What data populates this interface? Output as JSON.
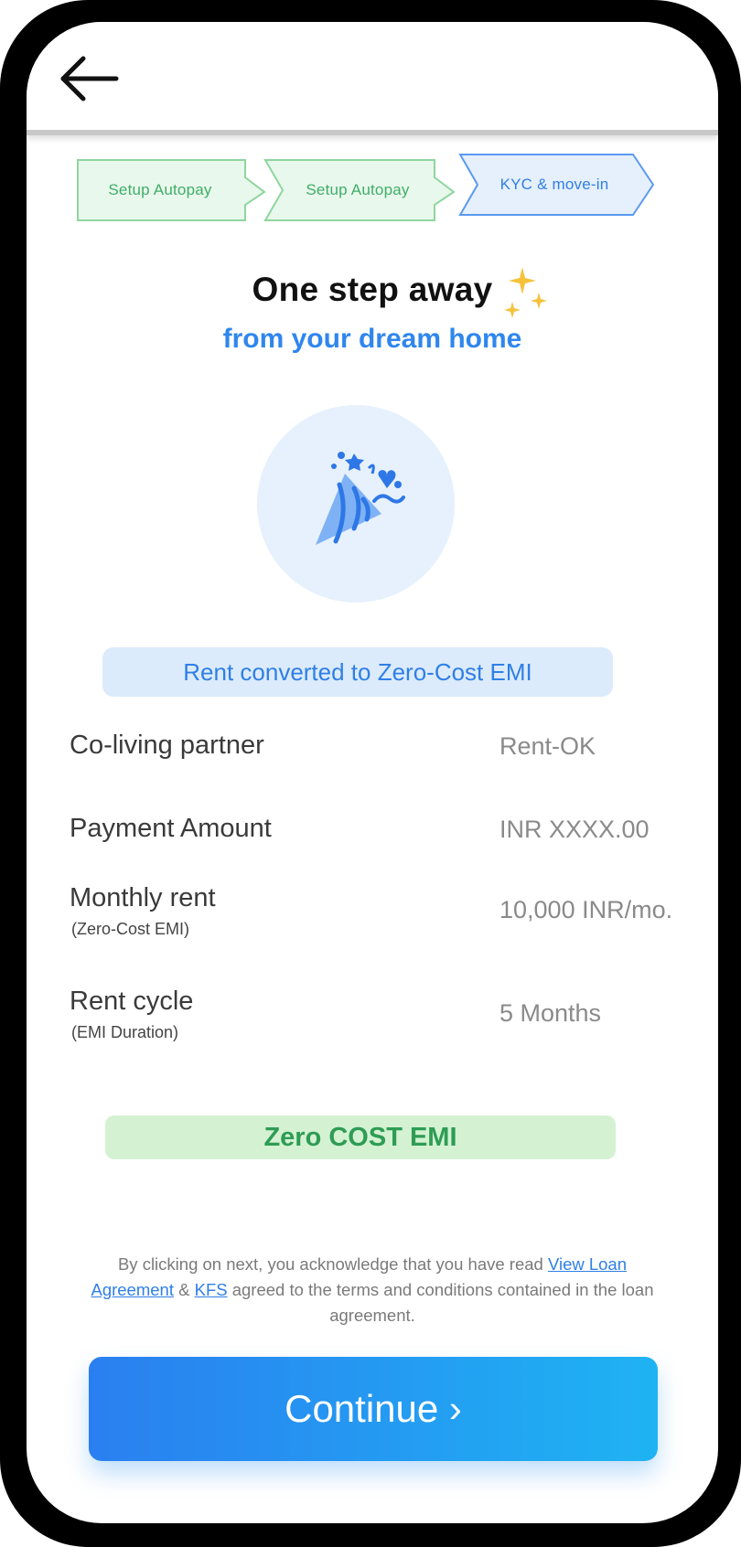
{
  "header": {
    "back_icon": "arrow-left-icon"
  },
  "stepper": {
    "steps": [
      {
        "label": "Setup Autopay",
        "state": "done"
      },
      {
        "label": "Setup Autopay",
        "state": "done"
      },
      {
        "label": "KYC  & move-in",
        "state": "active"
      }
    ]
  },
  "hero": {
    "title": "One step away",
    "subtitle": "from your dream home",
    "title_icon": "sparkles-icon",
    "illustration_icon": "party-popper-icon"
  },
  "banner": {
    "text": "Rent converted to Zero-Cost EMI"
  },
  "details": {
    "rows": [
      {
        "label": "Co-living partner",
        "sub": "",
        "value": "Rent-OK"
      },
      {
        "label": "Payment Amount",
        "sub": "",
        "value": "INR XXXX.00"
      },
      {
        "label": "Monthly rent",
        "sub": "(Zero-Cost EMI)",
        "value": "10,000 INR/mo."
      },
      {
        "label": "Rent cycle",
        "sub": "(EMI Duration)",
        "value": "5 Months"
      }
    ]
  },
  "zero_cost": {
    "text": "Zero COST EMI"
  },
  "disclaimer": {
    "part1": "By clicking on next, you acknowledge that you have read ",
    "link1": "View Loan Agreement",
    "part2": " & ",
    "link2": "KFS",
    "part3": " agreed to the terms and conditions contained in the loan agreement."
  },
  "continue_button": {
    "label": "Continue ›"
  },
  "colors": {
    "accent_blue": "#2f86ee",
    "success_green": "#3fae68",
    "button_gradient_start": "#2a7ff0",
    "button_gradient_end": "#1fb3f3"
  }
}
